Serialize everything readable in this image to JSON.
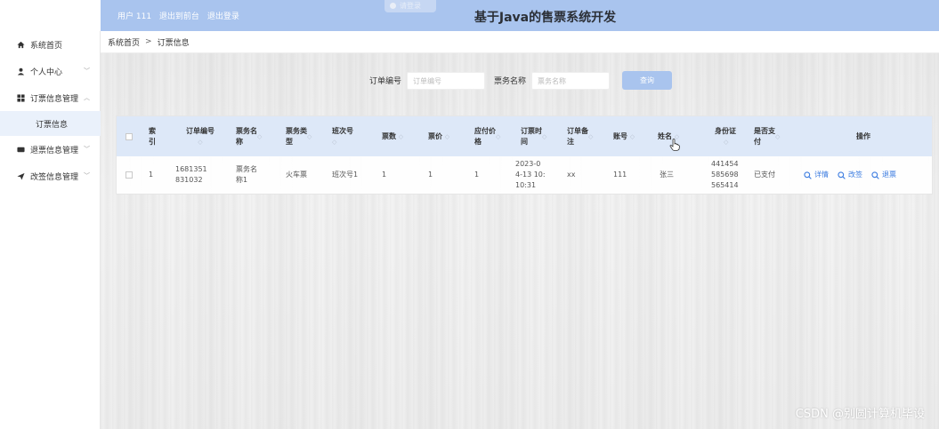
{
  "header": {
    "user_link": "用户 111",
    "back_link": "退出到前台",
    "logout_link": "退出登录",
    "title": "基于Java的售票系统开发",
    "ghost_label": "请登录"
  },
  "sidebar": {
    "items": [
      {
        "label": "系统首页",
        "icon": "home-icon"
      },
      {
        "label": "个人中心",
        "icon": "user-icon"
      },
      {
        "label": "订票信息管理",
        "icon": "grid-icon"
      },
      {
        "label": "订票信息",
        "icon": ""
      },
      {
        "label": "退票信息管理",
        "icon": "card-icon"
      },
      {
        "label": "改签信息管理",
        "icon": "send-icon"
      }
    ]
  },
  "breadcrumb": {
    "home": "系统首页",
    "sep": ">",
    "current": "订票信息"
  },
  "search": {
    "order_no_label": "订单编号",
    "order_no_placeholder": "订单编号",
    "ticket_name_label": "票务名称",
    "ticket_name_placeholder": "票务名称",
    "query_button": "查询"
  },
  "table": {
    "columns": [
      {
        "key": "index",
        "label": "索\n引"
      },
      {
        "key": "order_no",
        "label": "订单编号"
      },
      {
        "key": "ticket_name",
        "label": "票务名\n称"
      },
      {
        "key": "ticket_type",
        "label": "票务类\n型"
      },
      {
        "key": "trip_no",
        "label": "班次号"
      },
      {
        "key": "count",
        "label": "票数"
      },
      {
        "key": "price",
        "label": "票价"
      },
      {
        "key": "due",
        "label": "应付价\n格"
      },
      {
        "key": "time",
        "label": "订票时\n间"
      },
      {
        "key": "remark",
        "label": "订单备\n注"
      },
      {
        "key": "account",
        "label": "账号"
      },
      {
        "key": "name",
        "label": "姓名"
      },
      {
        "key": "id_card",
        "label": "身份证"
      },
      {
        "key": "paid",
        "label": "是否支\n付"
      },
      {
        "key": "ops",
        "label": "操作"
      }
    ],
    "rows": [
      {
        "index": "1",
        "order_no": "1681351\n831032",
        "ticket_name": "票务名\n称1",
        "ticket_type": "火车票",
        "trip_no": "班次号1",
        "count": "1",
        "price": "1",
        "due": "1",
        "time": "2023-0\n4-13 10:\n10:31",
        "remark": "xx",
        "account": "111",
        "name": "张三",
        "id_card": "441454\n585698\n565414",
        "paid": "已支付",
        "ops": [
          "详情",
          "改签",
          "退票"
        ]
      }
    ]
  },
  "watermark": "CSDN @别圆计算机毕设",
  "colors": {
    "header_blue": "#a9c4ee",
    "link_blue": "#3a7be0",
    "table_head": "#dde8f8"
  }
}
